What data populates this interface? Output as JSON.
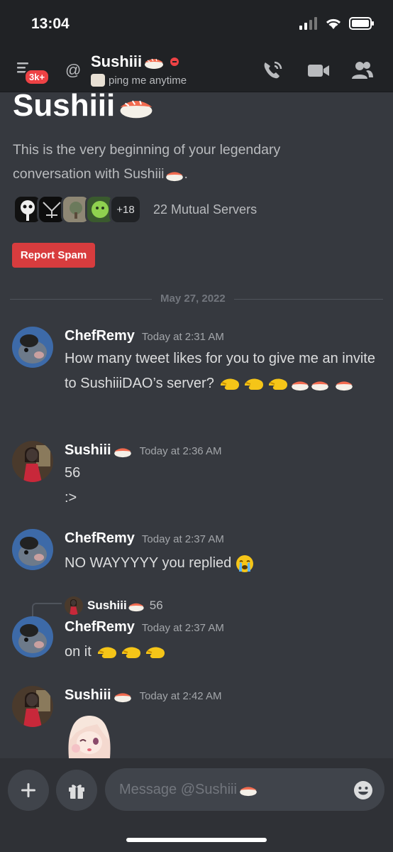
{
  "status_bar": {
    "time": "13:04"
  },
  "header": {
    "notification_badge": "3k+",
    "username": "Sushiii",
    "custom_status": "ping me anytime"
  },
  "profile": {
    "display_name": "Sushiii",
    "intro_text": "This is the very beginning of your legendary conversation with Sushiii",
    "intro_end": ".",
    "mutual_more": "+18",
    "mutual_servers": "22 Mutual Servers",
    "report_button": "Report Spam"
  },
  "date_divider": "May 27, 2022",
  "messages": [
    {
      "author": "ChefRemy",
      "timestamp": "Today at 2:31 AM",
      "text": "How many tweet likes for you to give me an invite to SushiiiDAO’s server?"
    },
    {
      "author": "Sushiii",
      "timestamp": "Today at 2:36 AM",
      "text": "56",
      "text2": ":>"
    },
    {
      "author": "ChefRemy",
      "timestamp": "Today at 2:37 AM",
      "text": "NO WAYYYYY you replied"
    },
    {
      "author": "ChefRemy",
      "timestamp": "Today at 2:37 AM",
      "text": "on it",
      "reply_author": "Sushiii",
      "reply_text": "56"
    },
    {
      "author": "Sushiii",
      "timestamp": "Today at 2:42 AM"
    }
  ],
  "composer": {
    "placeholder": "Message @Sushiii"
  },
  "colors": {
    "background": "#36393f",
    "header": "#202225",
    "danger": "#d83c3e",
    "composer": "#2f3136"
  }
}
